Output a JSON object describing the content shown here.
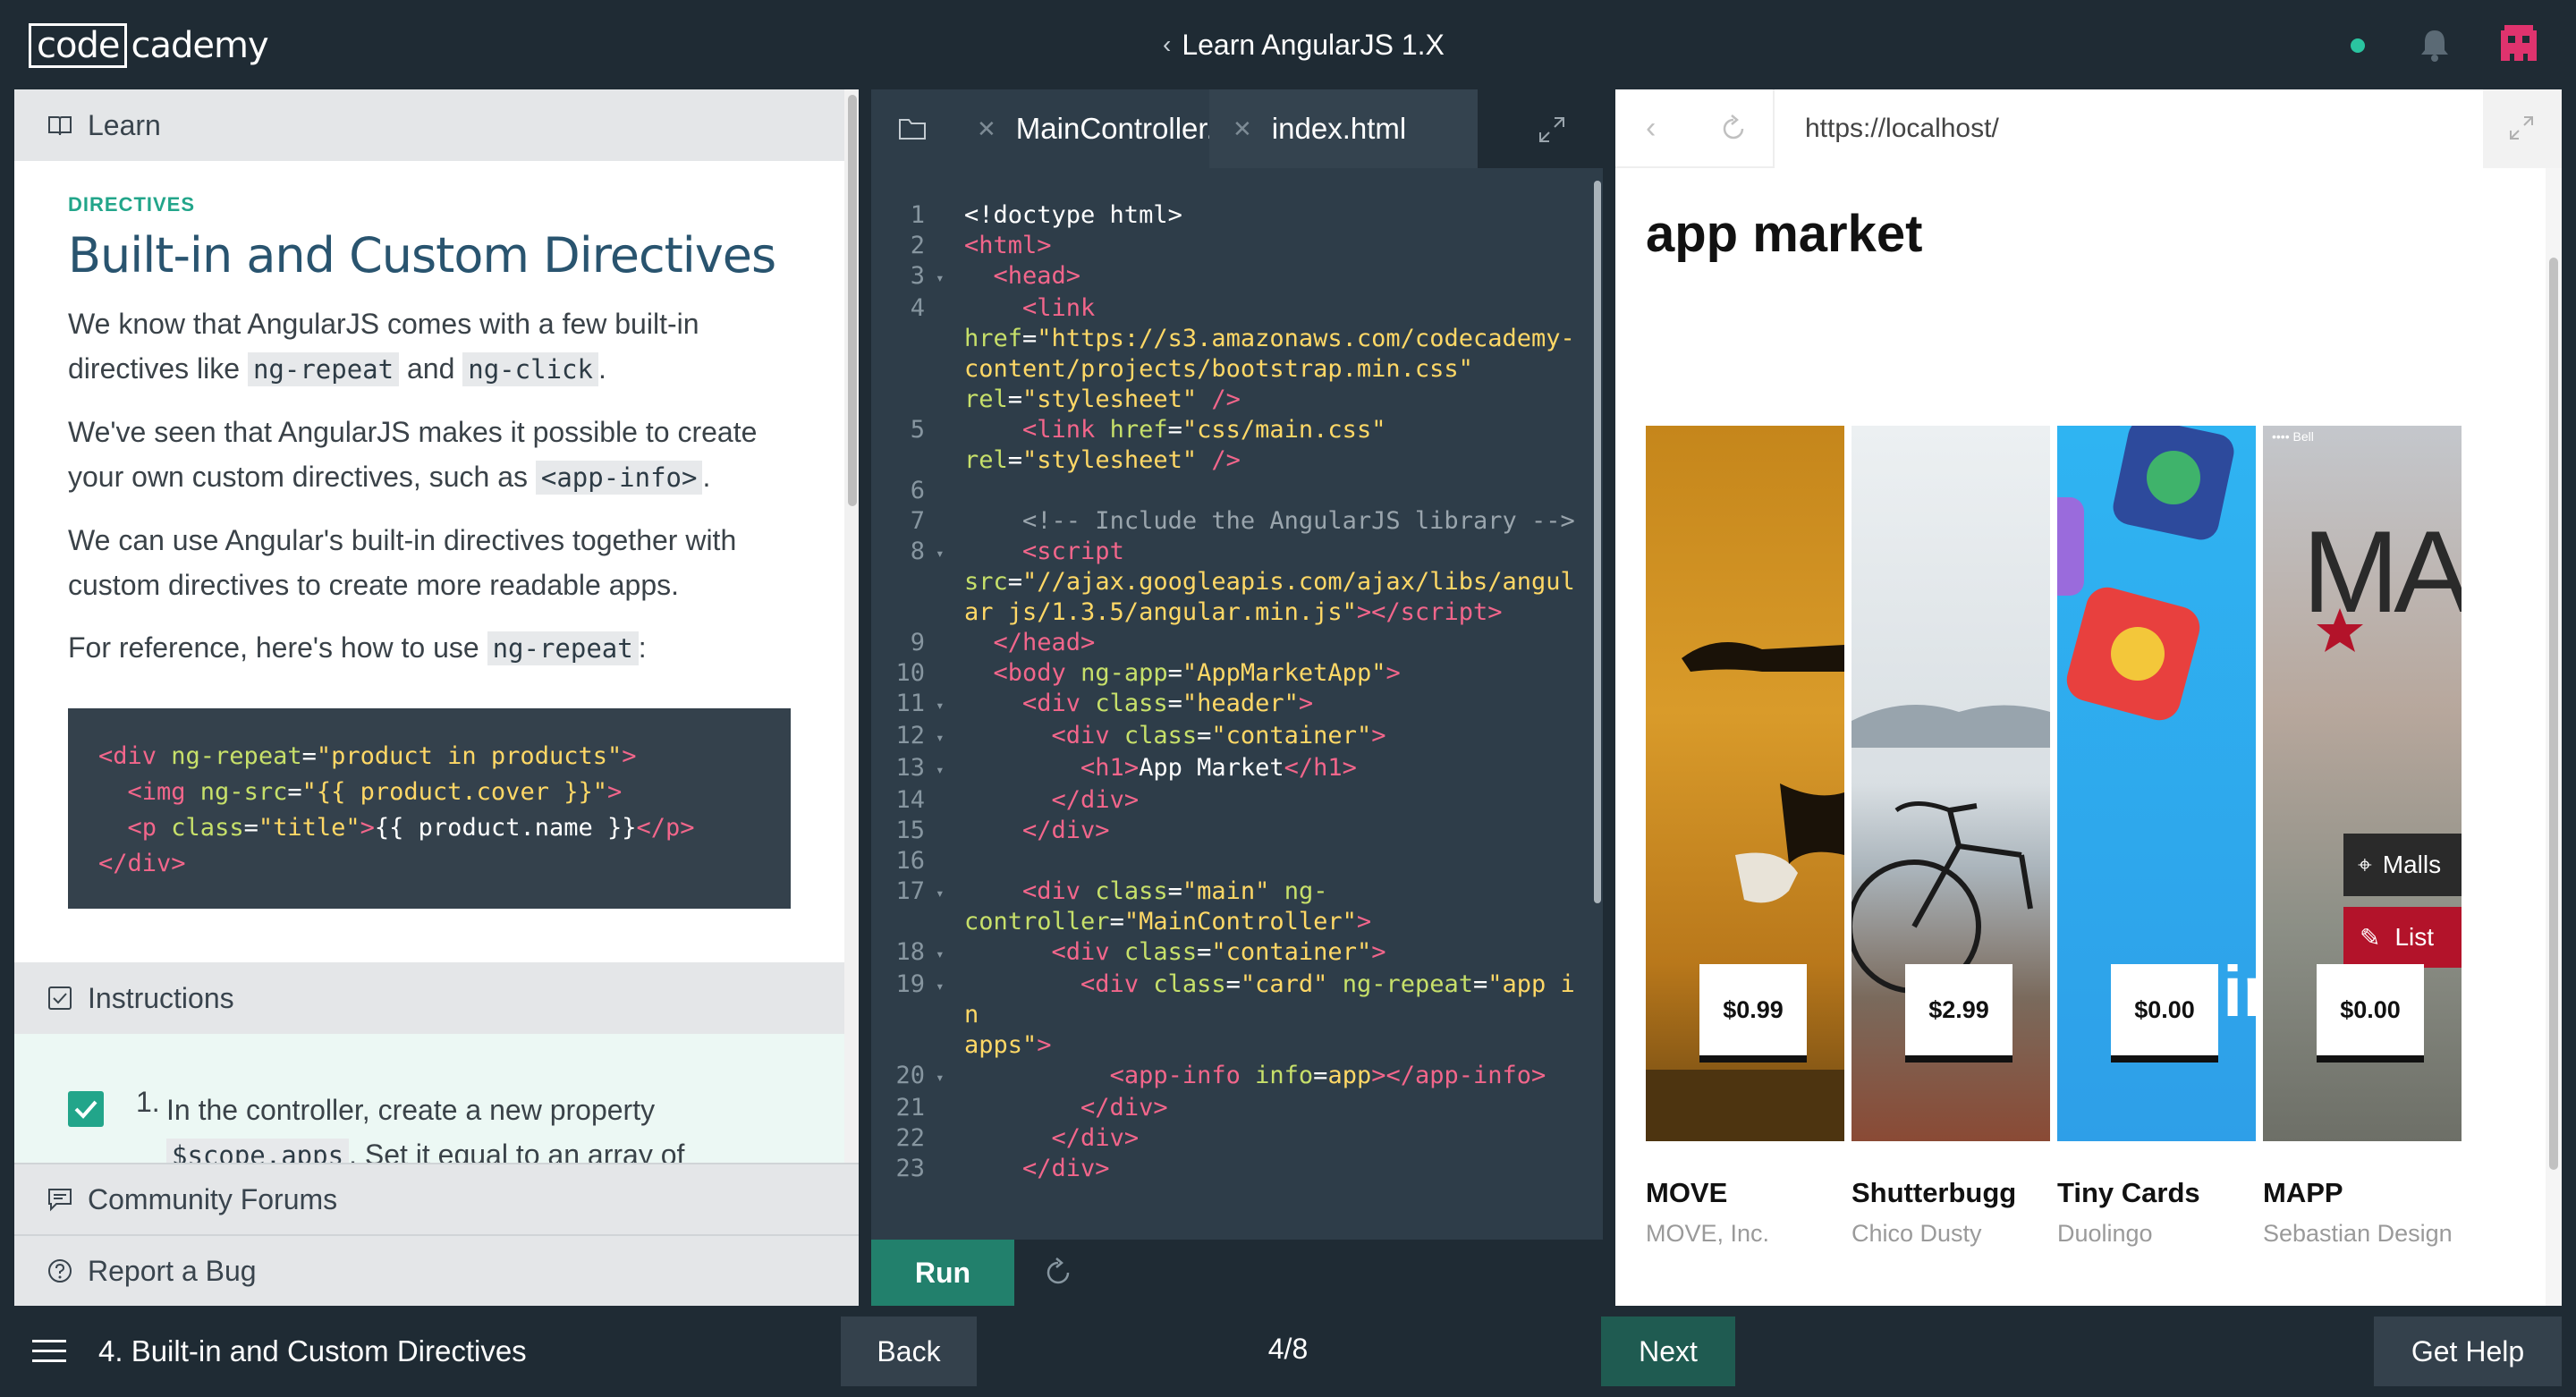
{
  "header": {
    "logo_left": "code",
    "logo_right": "cademy",
    "course_chevron": "‹",
    "course_title": "Learn AngularJS 1.X",
    "icons": [
      "status-dot",
      "bell-icon",
      "avatar-icon"
    ],
    "colors": {
      "status_dot": "#2ac4a0",
      "avatar": "#e0336e"
    }
  },
  "lesson": {
    "learn_label": "Learn",
    "kicker": "DIRECTIVES",
    "title": "Built-in and Custom Directives",
    "p1_a": "We know that AngularJS comes with a few built-in directives like ",
    "p1_code1": "ng-repeat",
    "p1_b": " and ",
    "p1_code2": "ng-click",
    "p1_c": ".",
    "p2_a": "We've seen that AngularJS makes it possible to create your own custom directives, such as ",
    "p2_code": "<app-info>",
    "p2_b": ".",
    "p3": "We can use Angular's built-in directives together with custom directives to create more readable apps.",
    "p4_a": "For reference, here's how to use ",
    "p4_code": "ng-repeat",
    "p4_b": ":",
    "code_lines": [
      {
        "tag1": "<div ",
        "attr1": "ng-repeat",
        "eq1": "=",
        "str1": "\"product in products\"",
        "end1": ">"
      },
      {
        "indent": "  ",
        "tag1": "<img ",
        "attr1": "ng-src",
        "eq1": "=",
        "str1": "\"{{ product.cover }}\"",
        "end1": ">"
      },
      {
        "indent": "  ",
        "tag1": "<p ",
        "attr1": "class",
        "eq1": "=",
        "str1": "\"title\"",
        "end1": ">",
        "text": "{{ product.name }}",
        "close": "</p>"
      },
      {
        "tag1": "</div>"
      }
    ],
    "instructions_label": "Instructions",
    "step_number": "1.",
    "step_text_a": "In the controller, create a new property",
    "step_code": "$scope.apps",
    "step_text_b": ". Set it equal to an array of",
    "community_label": "Community Forums",
    "bug_label": "Report a Bug"
  },
  "editor": {
    "tabs": [
      {
        "label": "MainController.js",
        "active": false
      },
      {
        "label": "index.html",
        "active": true
      }
    ],
    "run_label": "Run",
    "lines": [
      {
        "n": "1",
        "fold": "",
        "html": "<span class='t-plain'>&lt;!doctype html&gt;</span>"
      },
      {
        "n": "2",
        "fold": "",
        "html": "<span class='t-tag'>&lt;html&gt;</span>"
      },
      {
        "n": "3",
        "fold": "▾",
        "html": "  <span class='t-tag'>&lt;head&gt;</span>"
      },
      {
        "n": "4",
        "fold": "",
        "html": "    <span class='t-tag'>&lt;link</span>\n<span class='t-attr'>href</span>=<span class='t-str'>\"https://s3.amazonaws.com/codecademy-content/projects/bootstrap.min.css\"</span>\n<span class='t-attr'>rel</span>=<span class='t-str'>\"stylesheet\"</span> <span class='t-tag'>/&gt;</span>"
      },
      {
        "n": "5",
        "fold": "",
        "html": "    <span class='t-tag'>&lt;link</span> <span class='t-attr'>href</span>=<span class='t-str'>\"css/main.css\"</span>\n<span class='t-attr'>rel</span>=<span class='t-str'>\"stylesheet\"</span> <span class='t-tag'>/&gt;</span>"
      },
      {
        "n": "6",
        "fold": "",
        "html": " "
      },
      {
        "n": "7",
        "fold": "",
        "html": "    <span class='t-cmt'>&lt;!-- Include the AngularJS library --&gt;</span>"
      },
      {
        "n": "8",
        "fold": "▾",
        "html": "    <span class='t-tag'>&lt;script</span>\n<span class='t-attr'>src</span>=<span class='t-str'>\"//ajax.googleapis.com/ajax/libs/angular js/1.3.5/angular.min.js\"</span><span class='t-tag'>&gt;&lt;/script&gt;</span>"
      },
      {
        "n": "9",
        "fold": "",
        "html": "  <span class='t-tag'>&lt;/head&gt;</span>"
      },
      {
        "n": "10",
        "fold": "",
        "html": "  <span class='t-tag'>&lt;body</span> <span class='t-attr'>ng-app</span>=<span class='t-str'>\"AppMarketApp\"</span><span class='t-tag'>&gt;</span>"
      },
      {
        "n": "11",
        "fold": "▾",
        "html": "    <span class='t-tag'>&lt;div</span> <span class='t-attr'>class</span>=<span class='t-str'>\"header\"</span><span class='t-tag'>&gt;</span>"
      },
      {
        "n": "12",
        "fold": "▾",
        "html": "      <span class='t-tag'>&lt;div</span> <span class='t-attr'>class</span>=<span class='t-str'>\"container\"</span><span class='t-tag'>&gt;</span>"
      },
      {
        "n": "13",
        "fold": "▾",
        "html": "        <span class='t-tag'>&lt;h1&gt;</span>App Market<span class='t-tag'>&lt;/h1&gt;</span>"
      },
      {
        "n": "14",
        "fold": "",
        "html": "      <span class='t-tag'>&lt;/div&gt;</span>"
      },
      {
        "n": "15",
        "fold": "",
        "html": "    <span class='t-tag'>&lt;/div&gt;</span>"
      },
      {
        "n": "16",
        "fold": "",
        "html": " "
      },
      {
        "n": "17",
        "fold": "▾",
        "html": "    <span class='t-tag'>&lt;div</span> <span class='t-attr'>class</span>=<span class='t-str'>\"main\"</span> <span class='t-attr'>ng-\ncontroller</span>=<span class='t-str'>\"MainController\"</span><span class='t-tag'>&gt;</span>"
      },
      {
        "n": "18",
        "fold": "▾",
        "html": "      <span class='t-tag'>&lt;div</span> <span class='t-attr'>class</span>=<span class='t-str'>\"container\"</span><span class='t-tag'>&gt;</span>"
      },
      {
        "n": "19",
        "fold": "▾",
        "html": "        <span class='t-tag'>&lt;div</span> <span class='t-attr'>class</span>=<span class='t-str'>\"card\"</span> <span class='t-attr'>ng-repeat</span>=<span class='t-str'>\"app in\napps\"</span><span class='t-tag'>&gt;</span>"
      },
      {
        "n": "20",
        "fold": "▾",
        "html": "          <span class='t-tag'>&lt;app-info</span> <span class='t-attr'>info</span>=<span class='t-str'>app</span><span class='t-tag'>&gt;&lt;/app-info&gt;</span>"
      },
      {
        "n": "21",
        "fold": "",
        "html": "        <span class='t-tag'>&lt;/div&gt;</span>"
      },
      {
        "n": "22",
        "fold": "",
        "html": "      <span class='t-tag'>&lt;/div&gt;</span>"
      },
      {
        "n": "23",
        "fold": "",
        "html": "    <span class='t-tag'>&lt;/div&gt;</span>"
      }
    ]
  },
  "browser": {
    "back_glyph": "‹",
    "url": "https://localhost/",
    "page_title": "app market",
    "cards": [
      {
        "price": "$0.99",
        "name": "MOVE",
        "developer": "MOVE, Inc."
      },
      {
        "price": "$2.99",
        "name": "Shutterbugg",
        "developer": "Chico Dusty"
      },
      {
        "price": "$0.00",
        "name": "Tiny Cards",
        "developer": "Duolingo"
      },
      {
        "price": "$0.00",
        "name": "MAPP",
        "developer": "Sebastian Design"
      }
    ],
    "mapp_brand": "MA",
    "mapp_status": "•••• Bell",
    "mapp_tag_1": "Malls",
    "mapp_tag_2": "List"
  },
  "footer": {
    "lesson_name": "4. Built-in and Custom Directives",
    "back_label": "Back",
    "progress": "4/8",
    "next_label": "Next",
    "help_label": "Get Help"
  }
}
